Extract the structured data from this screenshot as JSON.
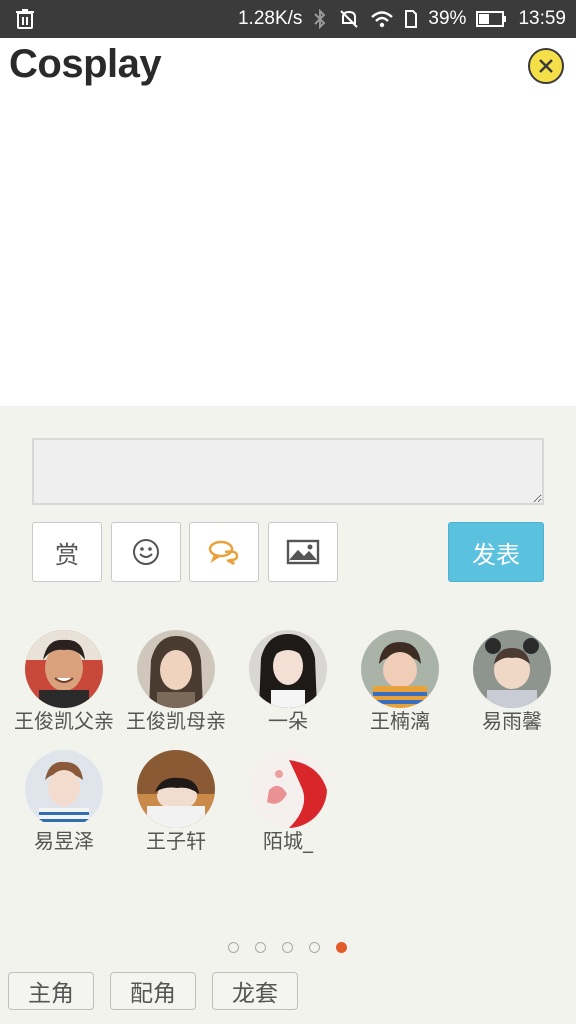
{
  "status_bar": {
    "speed": "1.28K/s",
    "battery": "39%",
    "time": "13:59"
  },
  "header": {
    "title": "Cosplay"
  },
  "composer": {
    "comment_value": "",
    "reward_label": "赏",
    "post_label": "发表"
  },
  "characters": [
    {
      "name": "王俊凯父亲",
      "avatar": "man-photo"
    },
    {
      "name": "王俊凯母亲",
      "avatar": "woman-photo"
    },
    {
      "name": "一朵",
      "avatar": "girl-photo"
    },
    {
      "name": "王楠漓",
      "avatar": "toddler-photo"
    },
    {
      "name": "易雨馨",
      "avatar": "baby-photo"
    },
    {
      "name": "易昱泽",
      "avatar": "boy-photo"
    },
    {
      "name": "王子轩",
      "avatar": "child-photo"
    },
    {
      "name": "陌城_",
      "avatar": "paint-photo"
    }
  ],
  "pagination": {
    "total": 5,
    "active": 5
  },
  "role_tabs": [
    "主角",
    "配角",
    "龙套"
  ],
  "colors": {
    "accent": "#5ac1de",
    "active_dot": "#e35a2b",
    "close_button": "#f6e04a",
    "panel_bg": "#f1f3ec"
  }
}
